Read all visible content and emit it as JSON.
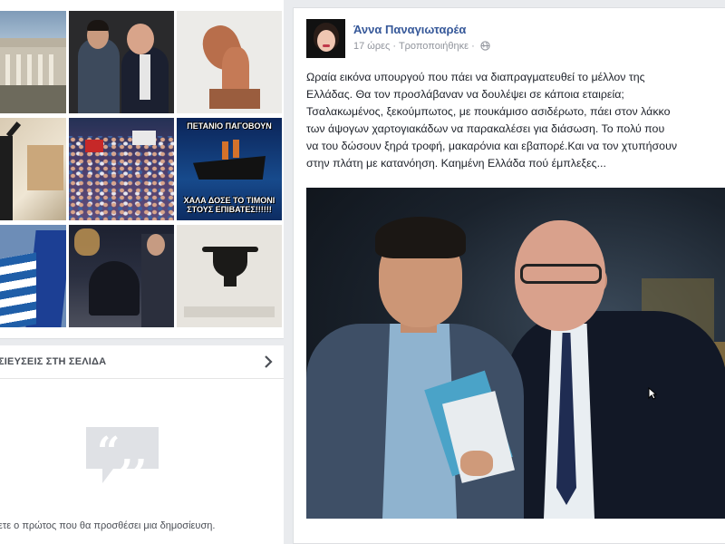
{
  "left": {
    "thumb_meme": {
      "top_text": "ΠΕΤΑΝΙΟ ΠΑΓΟΒΟΥΝ",
      "bottom_text": "ΧΑΛΑ ΔΟΣΕ ΤΟ ΤΙΜΟΝΙ ΣΤΟΥΣ ΕΠΙΒΑΤΕΣ!!!!!!"
    },
    "posts_section_title": "ΣΙΕΥΣΕΙΣ ΣΤΗ ΣΕΛΙΔΑ",
    "empty_state_text": "ίνετε ο πρώτος που θα προσθέσει μια δημοσίευση.",
    "icons": {
      "expand": "chevron-right-icon",
      "empty": "quote-bubble-icon"
    }
  },
  "post": {
    "author": "Άννα Παναγιωταρέα",
    "time": "17 ώρες",
    "edited": "Τροποποιήθηκε",
    "separator": "·",
    "privacy_icon": "globe-icon",
    "text_lines": [
      "Ωραία εικόνα υπουργού που πάει να διαπραγματευθεί το μέλλον της",
      "Ελλάδας. Θα τον προσλάβαναν να δουλέψει σε κάποια εταιρεία;",
      "Τσαλακωμένος, ξεκούμπωτος, με πουκάμισο ασιδέρωτο, πάει στον λάκκο",
      "των άψογων χαρτογιακάδων να παρακαλέσει για διάσωση. Το πολύ που",
      "να του δώσουν ξηρά τροφή, μακαρόνια και εβαπορέ.Και να τον χτυπήσουν",
      "στην πλάτη με κατανόηση. Καημένη Ελλάδα πού έμπλεξες..."
    ]
  },
  "colors": {
    "page_bg": "#e9ebee",
    "link": "#365899",
    "meta": "#90949c",
    "text": "#1d2129"
  }
}
